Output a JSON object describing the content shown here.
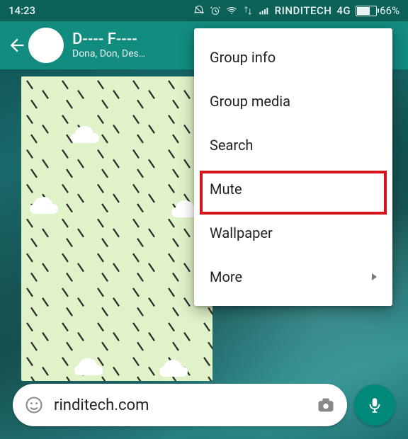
{
  "status": {
    "time": "14:23",
    "carrier": "RINDITECH",
    "network": "4G",
    "battery_pct": "66%"
  },
  "header": {
    "title": "D---- F----",
    "subtitle": "Dona, Don, Des…"
  },
  "menu": {
    "items": [
      {
        "label": "Group info"
      },
      {
        "label": "Group media"
      },
      {
        "label": "Search"
      },
      {
        "label": "Mute"
      },
      {
        "label": "Wallpaper"
      },
      {
        "label": "More"
      }
    ],
    "highlighted_index": 3
  },
  "input": {
    "text": "rinditech.com"
  }
}
